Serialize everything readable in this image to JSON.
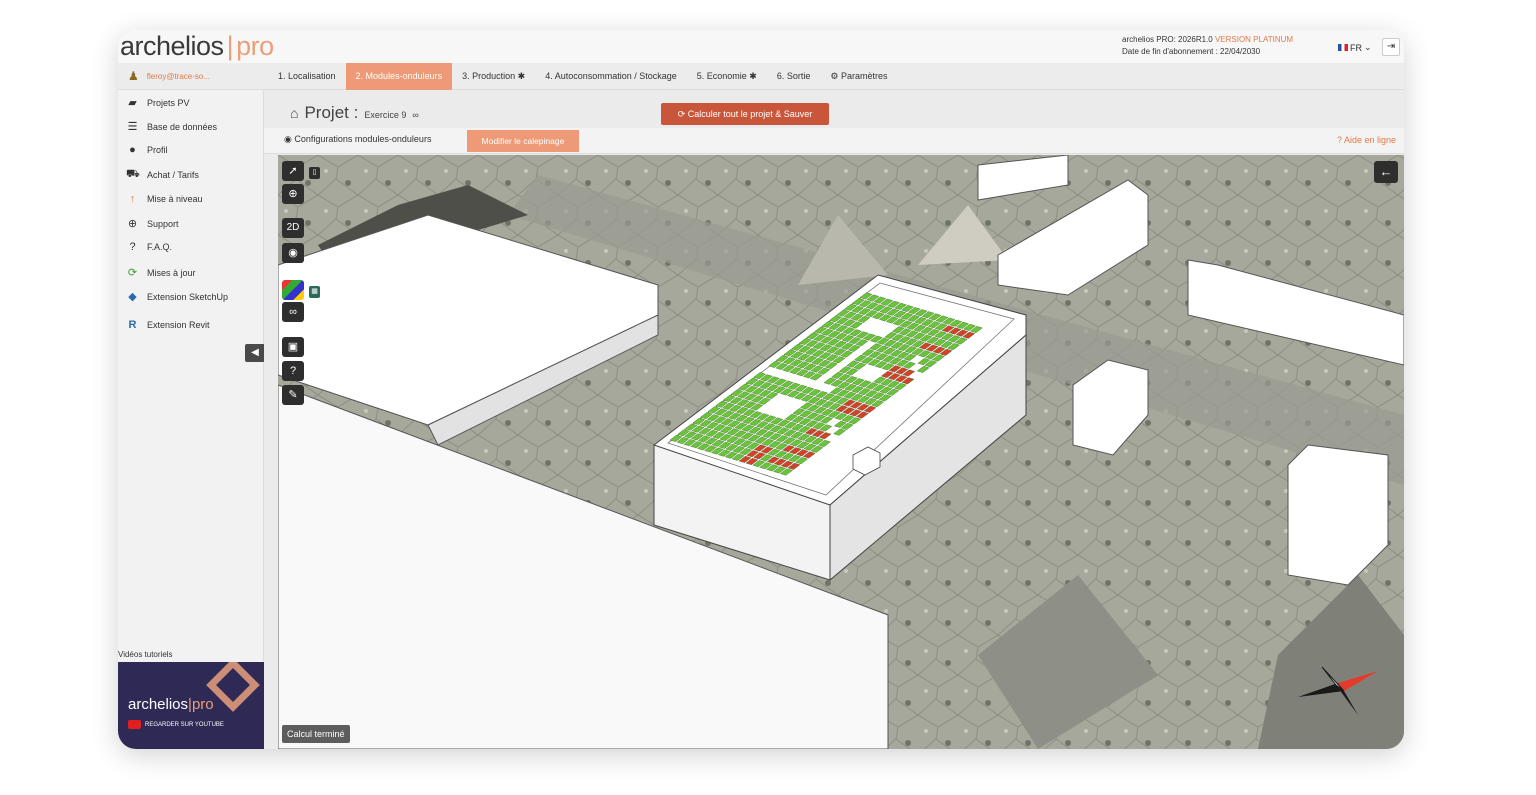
{
  "app": {
    "logo_main": "archelios",
    "logo_sep": "|",
    "logo_pro": "pro",
    "version_line": "archelios PRO: 2026R1.0",
    "version_tag": "VERSION PLATINUM",
    "subscription_line": "Date de fin d'abonnement : 22/04/2030",
    "language": "FR"
  },
  "user": {
    "email": "fleroy@trace-so..."
  },
  "tabs": [
    {
      "label": "1. Localisation"
    },
    {
      "label": "2. Modules-onduleurs"
    },
    {
      "label": "3. Production ✱"
    },
    {
      "label": "4. Autoconsommation / Stockage"
    },
    {
      "label": "5. Economie ✱"
    },
    {
      "label": "6. Sortie"
    },
    {
      "label": "⚙ Paramètres"
    }
  ],
  "sidebar": {
    "items": [
      {
        "label": "Projets PV",
        "icon": "folder-icon"
      },
      {
        "label": "Base de données",
        "icon": "database-icon"
      },
      {
        "label": "Profil",
        "icon": "user-icon"
      },
      {
        "label": "Achat / Tarifs",
        "icon": "cart-icon"
      },
      {
        "label": "Mise à niveau",
        "icon": "arrow-up-icon"
      },
      {
        "label": "Support",
        "icon": "lifebuoy-icon"
      },
      {
        "label": "F.A.Q.",
        "icon": "question-icon"
      },
      {
        "label": "Mises à jour",
        "icon": "refresh-icon"
      },
      {
        "label": "Extension SketchUp",
        "icon": "sketchup-icon"
      },
      {
        "label": "Extension Revit",
        "icon": "revit-icon"
      }
    ],
    "tutorials_label": "Vidéos tutoriels",
    "tutorial_banner": {
      "logo_main": "archelios",
      "logo_pro": "pro",
      "cta": "REGARDER SUR YOUTUBE"
    }
  },
  "project": {
    "title": "Projet :",
    "name": "Exercice 9",
    "calc_button": "⟳ Calculer tout le projet & Sauver"
  },
  "subbar": {
    "config_label": "Configurations modules-onduleurs",
    "edit_button": "Modifier le calepinage",
    "help_link": "? Aide en ligne"
  },
  "viewport": {
    "status": "Calcul terminé",
    "tool_2d": "2D"
  },
  "colors": {
    "accent": "#ee9a76",
    "calc_button": "#c9563a",
    "panel_ok": "#6ac43a",
    "panel_shaded": "#d6402a"
  }
}
